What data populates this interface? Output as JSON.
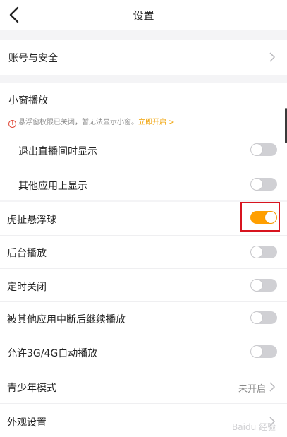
{
  "header": {
    "title": "设置"
  },
  "account": {
    "label": "账号与安全"
  },
  "mini_window": {
    "title": "小窗播放",
    "warning": "悬浮窗权限已关闭，暂无法显示小窗。",
    "warning_link": "立即开启 >",
    "items": [
      {
        "label": "退出直播间时显示",
        "enabled": false
      },
      {
        "label": "其他应用上显示",
        "enabled": false
      }
    ]
  },
  "settings": [
    {
      "label": "虎扯悬浮球",
      "enabled": true
    },
    {
      "label": "后台播放",
      "enabled": false
    },
    {
      "label": "定时关闭",
      "enabled": false
    },
    {
      "label": "被其他应用中断后继续播放",
      "enabled": false
    },
    {
      "label": "允许3G/4G自动播放",
      "enabled": false
    }
  ],
  "teen_mode": {
    "label": "青少年模式",
    "value": "未开启"
  },
  "appearance": {
    "label": "外观设置"
  },
  "watermark": "Baidu 经验",
  "colors": {
    "accent": "#ff9f00",
    "highlight": "#d8141f"
  }
}
